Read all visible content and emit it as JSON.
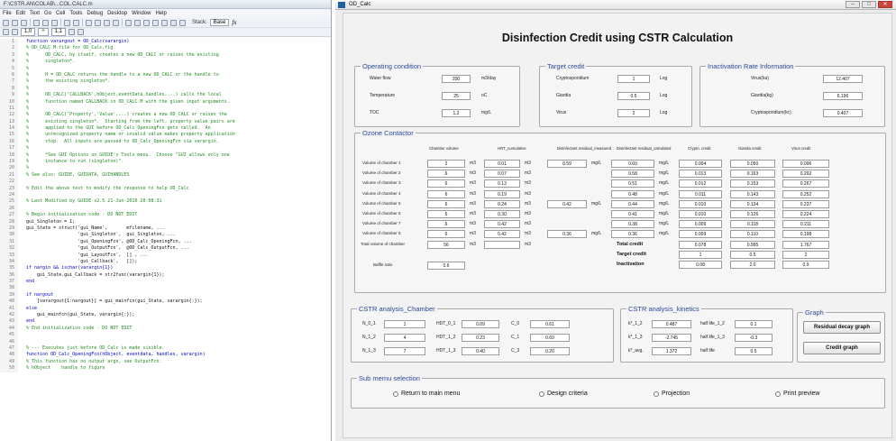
{
  "editor": {
    "title": "F:\\CSTR.AN\\COLAB\\...COL.CALC.m",
    "menu": [
      "File",
      "Edit",
      "Text",
      "Go",
      "Cell",
      "Tools",
      "Debug",
      "Desktop",
      "Window",
      "Help"
    ],
    "stack_label": "Stack:",
    "stack_value": "Base",
    "fx": "fx",
    "cell_size": "1.0",
    "cell_div": "÷",
    "cell_size2": "1.1",
    "lines": [
      {
        "n": "1",
        "t": "function varargout = OD_Calc(varargin)",
        "c": "kw"
      },
      {
        "n": "2",
        "t": "% OD_CALC M-file for OD_Calc.fig",
        "c": "cm"
      },
      {
        "n": "3",
        "t": "%      OD_CALC, by itself, creates a new OD_CALC or raises the existing",
        "c": "cm"
      },
      {
        "n": "4",
        "t": "%      singleton*.",
        "c": "cm"
      },
      {
        "n": "5",
        "t": "%",
        "c": "cm"
      },
      {
        "n": "6",
        "t": "%      H = OD_CALC returns the handle to a new OD_CALC or the handle to",
        "c": "cm"
      },
      {
        "n": "7",
        "t": "%      the existing singleton*.",
        "c": "cm"
      },
      {
        "n": "8",
        "t": "%",
        "c": "cm"
      },
      {
        "n": "9",
        "t": "%      OD_CALC('CALLBACK',hObject,eventData,handles,...) calls the local",
        "c": "cm"
      },
      {
        "n": "10",
        "t": "%      function named CALLBACK in OD_CALC.M with the given input arguments.",
        "c": "cm"
      },
      {
        "n": "11",
        "t": "%",
        "c": "cm"
      },
      {
        "n": "12",
        "t": "%      OD_CALC('Property','Value',...) creates a new OD_CALC or raises the",
        "c": "cm"
      },
      {
        "n": "13",
        "t": "%      existing singleton*.  Starting from the left, property value pairs are",
        "c": "cm"
      },
      {
        "n": "14",
        "t": "%      applied to the GUI before OD_Calc_OpeningFcn gets called.  An",
        "c": "cm"
      },
      {
        "n": "15",
        "t": "%      unrecognized property name or invalid value makes property application",
        "c": "cm"
      },
      {
        "n": "16",
        "t": "%      stop.  All inputs are passed to OD_Calc_OpeningFcn via varargin.",
        "c": "cm"
      },
      {
        "n": "17",
        "t": "%",
        "c": "cm"
      },
      {
        "n": "18",
        "t": "%      *See GUI Options on GUIDE's Tools menu.  Choose \"GUI allows only one",
        "c": "cm"
      },
      {
        "n": "19",
        "t": "%      instance to run (singleton)\".",
        "c": "cm"
      },
      {
        "n": "20",
        "t": "%",
        "c": "cm"
      },
      {
        "n": "21",
        "t": "% See also: GUIDE, GUIDATA, GUIHANDLES",
        "c": "cm"
      },
      {
        "n": "22",
        "t": "",
        "c": ""
      },
      {
        "n": "23",
        "t": "% Edit the above text to modify the response to help OD_Calc",
        "c": "cm"
      },
      {
        "n": "24",
        "t": "",
        "c": ""
      },
      {
        "n": "25",
        "t": "% Last Modified by GUIDE v2.5 21-Jun-2010 20:08:31",
        "c": "cm"
      },
      {
        "n": "26",
        "t": "",
        "c": ""
      },
      {
        "n": "27",
        "t": "% Begin initialization code - DO NOT EDIT",
        "c": "cm"
      },
      {
        "n": "28",
        "t": "gui_Singleton = 1;",
        "c": ""
      },
      {
        "n": "29",
        "t": "gui_State = struct('gui_Name',       mfilename, ...",
        "c": ""
      },
      {
        "n": "30",
        "t": "                   'gui_Singleton',  gui_Singleton, ...",
        "c": ""
      },
      {
        "n": "31",
        "t": "                   'gui_OpeningFcn', @OD_Calc_OpeningFcn, ...",
        "c": ""
      },
      {
        "n": "32",
        "t": "                   'gui_OutputFcn',  @OD_Calc_OutputFcn, ...",
        "c": ""
      },
      {
        "n": "33",
        "t": "                   'gui_LayoutFcn',  [] , ...",
        "c": ""
      },
      {
        "n": "34",
        "t": "                   'gui_Callback',   []);",
        "c": ""
      },
      {
        "n": "35",
        "t": "if nargin && ischar(varargin{1})",
        "c": "kw"
      },
      {
        "n": "36",
        "t": "    gui_State.gui_Callback = str2func(varargin{1});",
        "c": ""
      },
      {
        "n": "37",
        "t": "end",
        "c": "kw"
      },
      {
        "n": "38",
        "t": "",
        "c": ""
      },
      {
        "n": "39",
        "t": "if nargout",
        "c": "kw"
      },
      {
        "n": "40",
        "t": "    [varargout{1:nargout}] = gui_mainfcn(gui_State, varargin{:});",
        "c": ""
      },
      {
        "n": "41",
        "t": "else",
        "c": "kw"
      },
      {
        "n": "42",
        "t": "    gui_mainfcn(gui_State, varargin{:});",
        "c": ""
      },
      {
        "n": "43",
        "t": "end",
        "c": "kw"
      },
      {
        "n": "44",
        "t": "% End initialization code - DO NOT EDIT",
        "c": "cm"
      },
      {
        "n": "45",
        "t": "",
        "c": ""
      },
      {
        "n": "46",
        "t": "",
        "c": ""
      },
      {
        "n": "47",
        "t": "% --- Executes just before OD_Calc is made visible.",
        "c": "cm"
      },
      {
        "n": "48",
        "t": "function OD_Calc_OpeningFcn(hObject, eventdata, handles, varargin)",
        "c": "kw"
      },
      {
        "n": "49",
        "t": "% This function has no output args, see OutputFcn.",
        "c": "cm"
      },
      {
        "n": "50",
        "t": "% hObject    handle to figure",
        "c": "cm"
      }
    ]
  },
  "figure": {
    "window_title": "OD_Calc",
    "heading": "Disinfection Credit using CSTR Calculation",
    "operating": {
      "title": "Operating condition",
      "rows": [
        {
          "label": "Water flow",
          "value": "200",
          "unit": "m3/day"
        },
        {
          "label": "Temperature",
          "value": "25",
          "unit": "oC"
        },
        {
          "label": "TOC",
          "value": "1.2",
          "unit": "mg/L"
        }
      ]
    },
    "target": {
      "title": "Target credit",
      "rows": [
        {
          "label": "Cryptosporidium",
          "value": "1",
          "unit": "Log"
        },
        {
          "label": "Giardia",
          "value": "0.5",
          "unit": "Log"
        },
        {
          "label": "Virus",
          "value": "2",
          "unit": "Log"
        }
      ]
    },
    "inactivation": {
      "title": "Inactivation Rate Information",
      "rows": [
        {
          "label": "Virus(ka)",
          "value": "12.407"
        },
        {
          "label": "Giardia(kg)",
          "value": "6.196"
        },
        {
          "label": "Cryptosporidium(kc)",
          "value": "0.407"
        }
      ]
    },
    "ozone": {
      "title": "Ozone Contactor",
      "headers": [
        "Chamber volume",
        "HRT_cumulative",
        "Disinfectant residual_measured",
        "Disinfectant residual_calculated",
        "Crypto. credit",
        "Giardia credit",
        "Virus credit"
      ],
      "rows": [
        {
          "label": "Volume of chamber 1",
          "vol": "2",
          "u1": "m3",
          "hrt": "0.01",
          "u2": "m3",
          "meas": "0.59",
          "u3": "mg/L",
          "calc": "0.60",
          "u4": "mg/L",
          "c": "0.004",
          "g": "0.050",
          "v": "0.096"
        },
        {
          "label": "Volume of chamber 2",
          "vol": "6",
          "u1": "m3",
          "hrt": "0.07",
          "u2": "m3",
          "meas": "",
          "u3": "",
          "calc": "0.58",
          "u4": "mg/L",
          "c": "0.013",
          "g": "0.163",
          "v": "0.292"
        },
        {
          "label": "Volume of chamber 3",
          "vol": "6",
          "u1": "m3",
          "hrt": "0.13",
          "u2": "m3",
          "meas": "",
          "u3": "",
          "calc": "0.51",
          "u4": "mg/L",
          "c": "0.012",
          "g": "0.153",
          "v": "0.267"
        },
        {
          "label": "Volume of chamber 4",
          "vol": "6",
          "u1": "m3",
          "hrt": "0.19",
          "u2": "m3",
          "meas": "",
          "u3": "",
          "calc": "0.48",
          "u4": "mg/L",
          "c": "0.011",
          "g": "0.143",
          "v": "0.252"
        },
        {
          "label": "Volume of chamber 5",
          "vol": "6",
          "u1": "m3",
          "hrt": "0.24",
          "u2": "m3",
          "meas": "0.42",
          "u3": "mg/L",
          "calc": "0.44",
          "u4": "mg/L",
          "c": "0.010",
          "g": "0.134",
          "v": "0.237"
        },
        {
          "label": "Volume of chamber 6",
          "vol": "6",
          "u1": "m3",
          "hrt": "0.30",
          "u2": "m3",
          "meas": "",
          "u3": "",
          "calc": "0.41",
          "u4": "mg/L",
          "c": "0.010",
          "g": "0.126",
          "v": "0.224"
        },
        {
          "label": "Volume of chamber 7",
          "vol": "6",
          "u1": "m3",
          "hrt": "0.42",
          "u2": "m3",
          "meas": "",
          "u3": "",
          "calc": "0.38",
          "u4": "mg/L",
          "c": "0.009",
          "g": "0.118",
          "v": "0.211"
        },
        {
          "label": "Volume of chamber 8",
          "vol": "6",
          "u1": "m3",
          "hrt": "0.42",
          "u2": "m3",
          "meas": "0.36",
          "u3": "mg/L",
          "calc": "0.36",
          "u4": "mg/L",
          "c": "0.009",
          "g": "0.110",
          "v": "0.198"
        }
      ],
      "total_label": "Total volume of chamber",
      "total_value": "56",
      "total_unit": "m3",
      "baffle_label": "Baffle ratio",
      "baffle_value": "0.6",
      "summary": [
        {
          "label": "Total credit",
          "c": "0.078",
          "g": "0.995",
          "v": "1.767"
        },
        {
          "label": "Target credit",
          "c": "1",
          "g": "0.5",
          "v": "2"
        },
        {
          "label": "Inactivation",
          "c": "0.08",
          "g": "2.0",
          "v": "0.9"
        }
      ]
    },
    "cstr_chamber": {
      "title": "CSTR analysis_Chamber",
      "rows": [
        {
          "a": "N_0_1",
          "av": "1",
          "b": "HDT_0_1",
          "bv": "0.09",
          "c": "C_0",
          "cv": "0.61"
        },
        {
          "a": "N_1_2",
          "av": "4",
          "b": "HDT_1_2",
          "bv": "0.23",
          "c": "C_1",
          "cv": "0.60"
        },
        {
          "a": "N_1_3",
          "av": "7",
          "b": "HDT_1_3",
          "bv": "0.40",
          "c": "C_3",
          "cv": "0.20"
        }
      ]
    },
    "cstr_kinetics": {
      "title": "CSTR analysis_kinetics",
      "rows": [
        {
          "a": "k*_1_2",
          "av": "0.487",
          "b": "half life_1_2",
          "bv": "0.1"
        },
        {
          "a": "k*_1_3",
          "av": "-2.745",
          "b": "half life_1_3",
          "bv": "-0.3"
        },
        {
          "a": "k*_avg.",
          "av": "1.372",
          "b": "half life",
          "bv": "0.5"
        }
      ]
    },
    "graph": {
      "title": "Graph",
      "residual_btn": "Residual decay graph",
      "credit_btn": "Credit graph"
    },
    "submenu": {
      "title": "Sub memu selection",
      "options": [
        "Return to main menu",
        "Design criteria",
        "Projection",
        "Print preview"
      ]
    }
  }
}
